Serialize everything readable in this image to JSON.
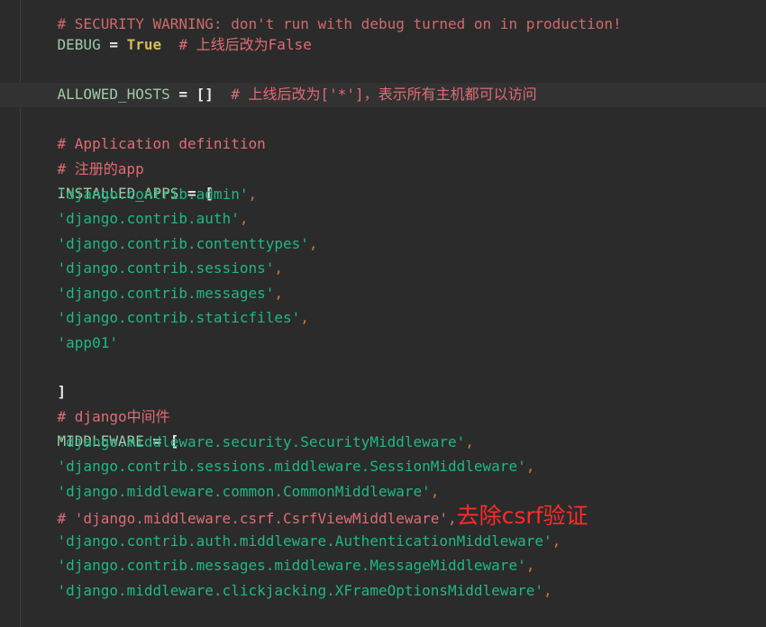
{
  "code": {
    "line_security_comment": "# SECURITY WARNING: don't run with debug turned on in production!",
    "debug": {
      "name": "DEBUG",
      "op": " = ",
      "value": "True",
      "comment": "  # 上线后改为False"
    },
    "allowed_hosts": {
      "name": "ALLOWED_HOSTS",
      "op": " = ",
      "value": "[]",
      "comment": "  # 上线后改为['*']，表示所有主机都可以访问"
    },
    "app_def_comment": "# Application definition",
    "registered_app_comment": "# 注册的app",
    "installed_apps": {
      "name": "INSTALLED_APPS",
      "op": " = ",
      "open": "[",
      "close": "]",
      "items": [
        "'django.contrib.admin'",
        "'django.contrib.auth'",
        "'django.contrib.contenttypes'",
        "'django.contrib.sessions'",
        "'django.contrib.messages'",
        "'django.contrib.staticfiles'",
        "'app01'"
      ]
    },
    "middleware_comment": "# django中间件",
    "middleware": {
      "name": "MIDDLEWARE",
      "op": " = ",
      "open": "[",
      "close": "]",
      "items": [
        "'django.middleware.security.SecurityMiddleware'",
        "'django.contrib.sessions.middleware.SessionMiddleware'",
        "'django.middleware.common.CommonMiddleware'",
        "# 'django.middleware.csrf.CsrfViewMiddleware'",
        "'django.contrib.auth.middleware.AuthenticationMiddleware'",
        "'django.contrib.messages.middleware.MessageMiddleware'",
        "'django.middleware.clickjacking.XFrameOptionsMiddleware'"
      ],
      "csrf_annotation": "去除csrf验证"
    },
    "comma": ","
  },
  "colors": {
    "background": "#2b2b2b",
    "comment": "#e06c75",
    "string": "#1fb884",
    "keyword": "#d7ba5a",
    "variable": "#9fcaa8",
    "annotation": "#ff2a2a"
  }
}
